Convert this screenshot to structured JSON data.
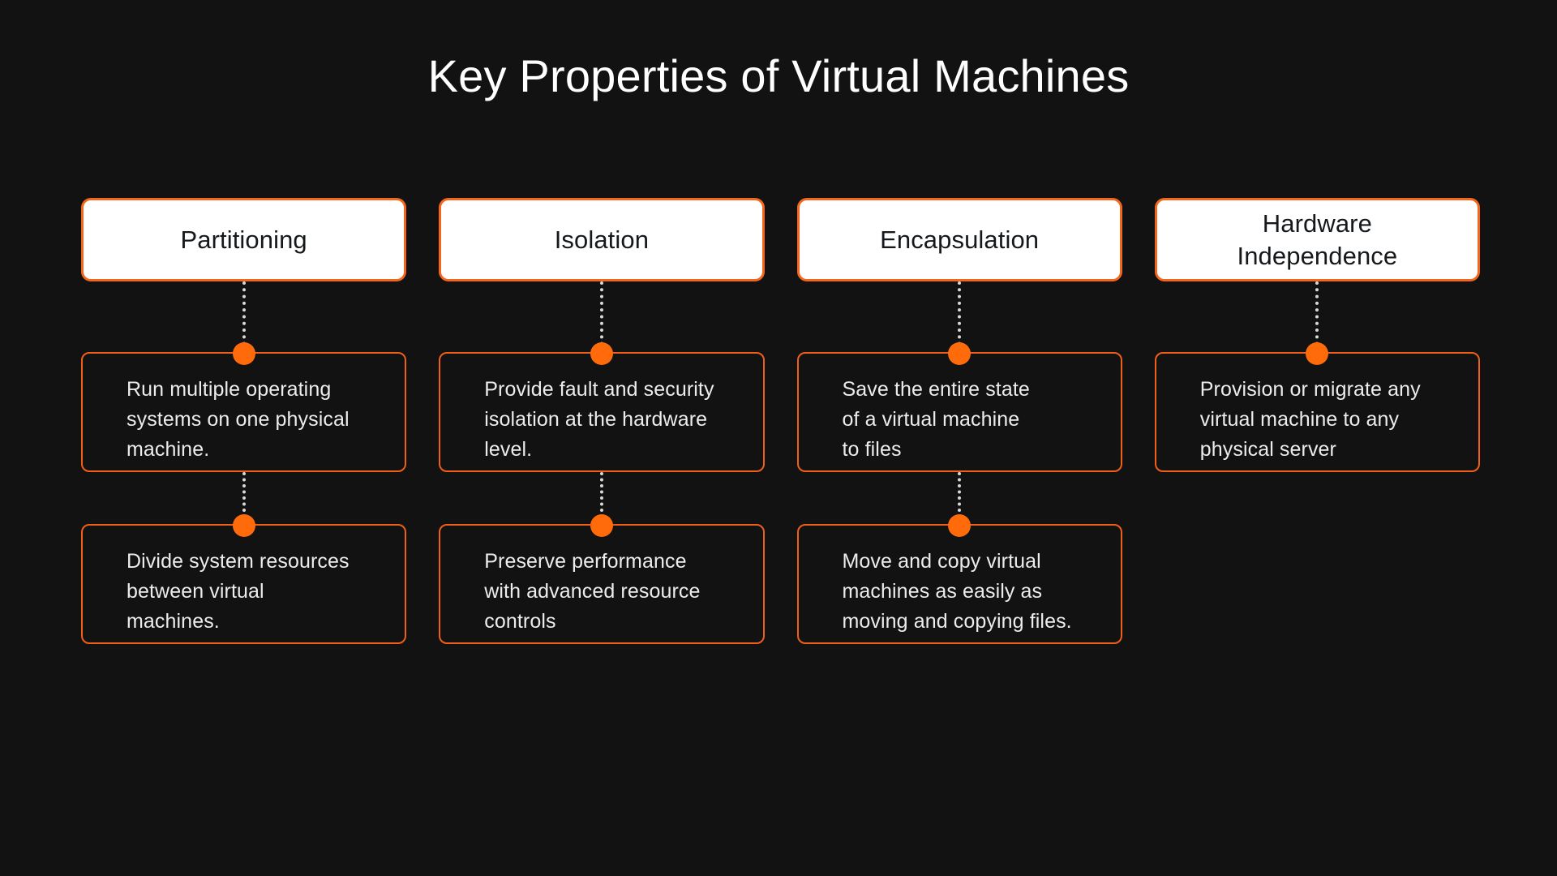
{
  "slide": {
    "title": "Key Properties of Virtual Machines",
    "background_color": "#121212",
    "accent_color": "#ef5f17",
    "node_dot_color": "#ff6b0b",
    "header_fill_color": "#ffffff",
    "header_text_color": "#16191c",
    "body_text_color": "#ececed",
    "connector_style": "dotted",
    "connector_color": "#d8d8d8"
  },
  "columns": [
    {
      "header": "Partitioning",
      "items": [
        "Run multiple operating\nsystems on one physical\nmachine.",
        "Divide system resources\nbetween virtual\nmachines."
      ]
    },
    {
      "header": "Isolation",
      "items": [
        "Provide fault and security\nisolation at the hardware\nlevel.",
        "Preserve performance\nwith advanced resource\ncontrols"
      ]
    },
    {
      "header": "Encapsulation",
      "items": [
        "Save the entire state\nof a virtual machine\nto files",
        "Move and copy virtual\nmachines as easily as\nmoving and copying files."
      ]
    },
    {
      "header": "Hardware\nIndependence",
      "items": [
        "Provision or migrate any\nvirtual machine to any\nphysical server"
      ]
    }
  ]
}
